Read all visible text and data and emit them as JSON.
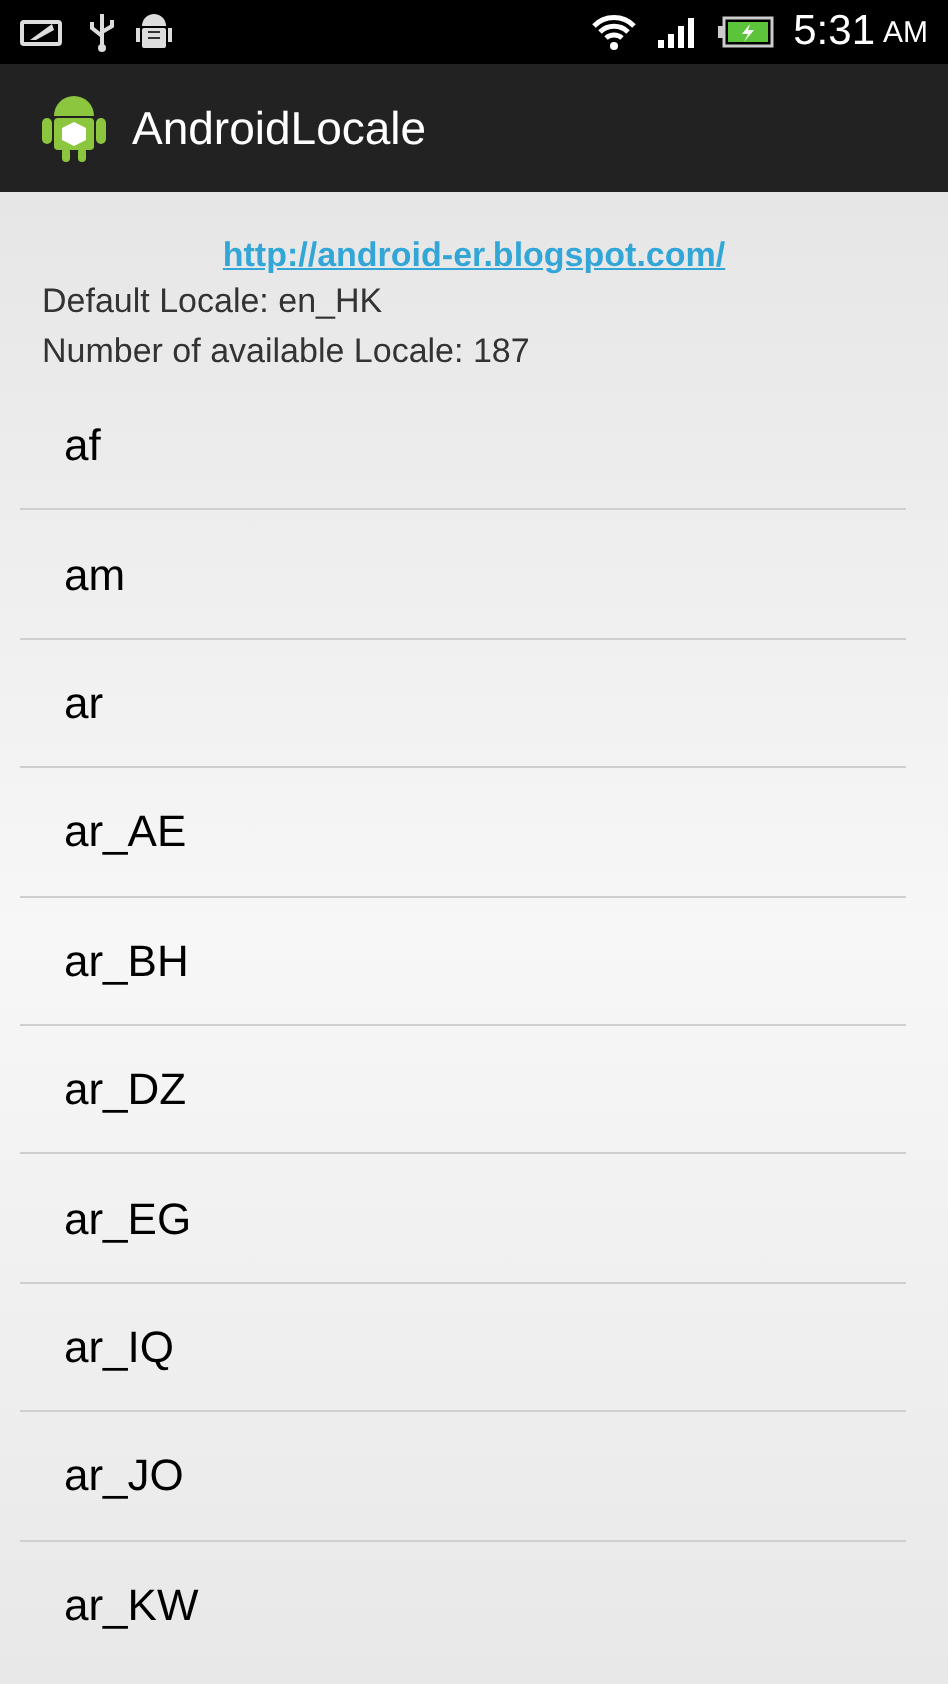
{
  "status_bar": {
    "time": "5:31",
    "meridiem": "AM"
  },
  "action_bar": {
    "title": "AndroidLocale"
  },
  "link": "http://android-er.blogspot.com/",
  "default_locale": "Default Locale: en_HK",
  "locale_count": "Number of available Locale: 187",
  "locales": [
    "af",
    "am",
    "ar",
    "ar_AE",
    "ar_BH",
    "ar_DZ",
    "ar_EG",
    "ar_IQ",
    "ar_JO",
    "ar_KW"
  ]
}
